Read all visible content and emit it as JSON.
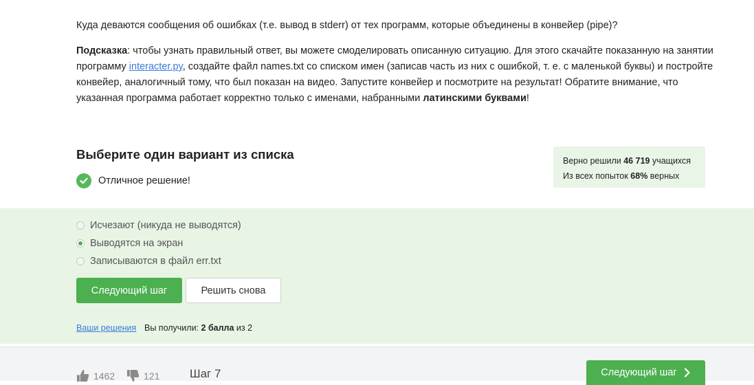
{
  "question": {
    "text": "Куда деваются сообщения об ошибках (т.е. вывод в stderr) от тех программ, которые объединены в конвейер (pipe)?",
    "hint_label": "Подсказка",
    "hint_part1": ": чтобы узнать правильный ответ, вы можете смоделировать описанную ситуацию. Для этого скачайте показанную на занятии программу ",
    "hint_link": "interacter.py",
    "hint_part2": ", создайте файл names.txt со списком имен (записав часть из них с ошибкой, т. е. с маленькой буквы) и постройте конвейер, аналогичный тому, что был показан на видео. Запустите конвейер и посмотрите на результат! Обратите внимание, что указанная программа работает корректно только с именами, набранными ",
    "hint_bold": "латинскими буквами",
    "hint_end": "!"
  },
  "quiz": {
    "title": "Выберите один вариант из списка",
    "feedback": "Отличное решение!",
    "stats": {
      "solved_prefix": "Верно решили ",
      "solved_count": "46 719",
      "solved_suffix": " учащихся",
      "attempts_prefix": "Из всех попыток ",
      "attempts_pct": "68%",
      "attempts_suffix": " верных"
    },
    "options": [
      {
        "label": "Исчезают (никуда не выводятся)",
        "checked": false
      },
      {
        "label": "Выводятся на экран",
        "checked": true
      },
      {
        "label": "Записываются в файл err.txt",
        "checked": false
      }
    ],
    "next_step_button": "Следующий шаг",
    "retry_button": "Решить снова",
    "your_solutions": "Ваши решения",
    "score_prefix": "Вы получили: ",
    "score_value": "2 балла",
    "score_suffix": " из 2"
  },
  "footer": {
    "likes": "1462",
    "dislikes": "121",
    "step": "Шаг 7",
    "next_button": "Следующий шаг"
  },
  "colors": {
    "accent_green": "#4caf50",
    "answer_bg": "#e8f5e5",
    "link": "#3b7ad9"
  }
}
